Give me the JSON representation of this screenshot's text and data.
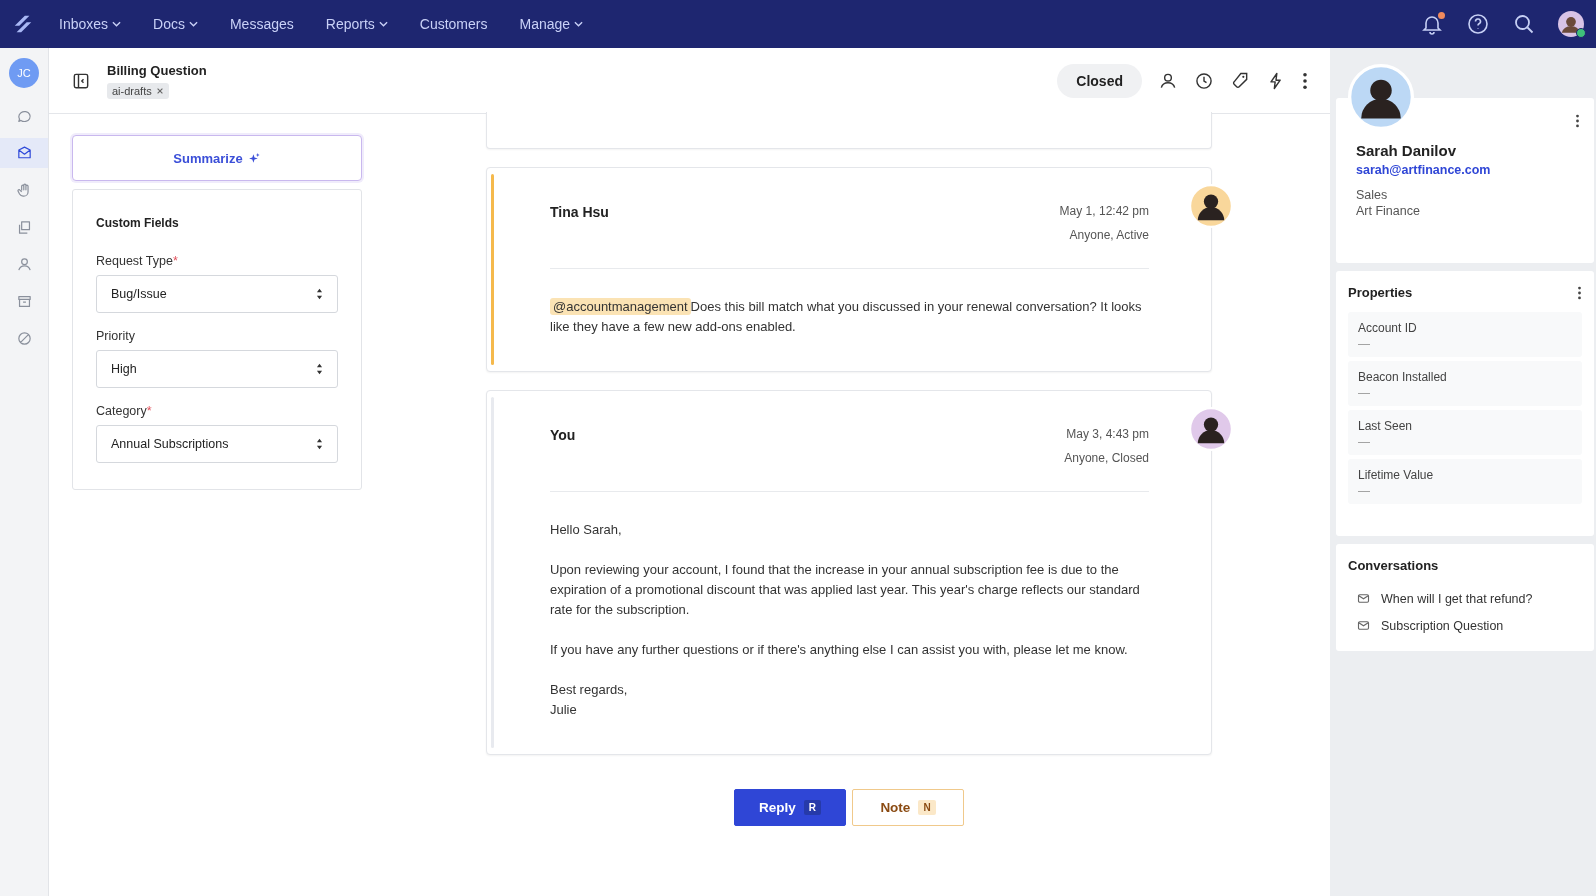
{
  "nav": [
    {
      "label": "Inboxes",
      "dropdown": true
    },
    {
      "label": "Docs",
      "dropdown": true
    },
    {
      "label": "Messages",
      "dropdown": false
    },
    {
      "label": "Reports",
      "dropdown": true
    },
    {
      "label": "Customers",
      "dropdown": false
    },
    {
      "label": "Manage",
      "dropdown": true
    }
  ],
  "top_icons": {
    "notification": true,
    "online": true
  },
  "rail": {
    "user_initials": "JC",
    "items": [
      {
        "kind": "chat",
        "selected": false
      },
      {
        "kind": "inbox",
        "selected": true
      },
      {
        "kind": "hand",
        "selected": false
      },
      {
        "kind": "layers",
        "selected": false
      },
      {
        "kind": "person",
        "selected": false
      },
      {
        "kind": "archive",
        "selected": false
      },
      {
        "kind": "block",
        "selected": false
      }
    ]
  },
  "header": {
    "title": "Billing Question",
    "tag": "ai-drafts",
    "status": "Closed"
  },
  "summarize": "Summarize",
  "custom_fields": {
    "title": "Custom Fields",
    "fields": [
      {
        "label": "Request Type",
        "required_mark": "*",
        "value": "Bug/Issue"
      },
      {
        "label": "Priority",
        "value": "High"
      },
      {
        "label": "Category",
        "required_mark": "*",
        "value": "Annual Subscriptions"
      }
    ]
  },
  "messages": [
    {
      "kind": "note",
      "author": "Tina Hsu",
      "time": "May 1, 12:42 pm",
      "meta": "Anyone, Active",
      "mention": "@accountmanagement",
      "paragraphs": [
        [
          "Does this bill match what you discussed in your renewal conversation? It looks like they have a few new add-ons enabled."
        ]
      ]
    },
    {
      "kind": "reply",
      "author": "You",
      "time": "May 3, 4:43 pm",
      "meta": "Anyone, Closed",
      "paragraphs": [
        [
          "Hello Sarah,"
        ],
        [
          "Upon reviewing your account, I found that the increase in your annual subscription fee is due to the expiration of a promotional discount that was applied last year. This year's charge reflects our standard rate for the subscription."
        ],
        [
          "If you have any further questions or if there's anything else I can assist you with, please let me know."
        ],
        [
          "Best regards,",
          "Julie"
        ]
      ]
    }
  ],
  "actions": [
    {
      "kind": "reply",
      "label": "Reply",
      "key": "R"
    },
    {
      "kind": "note",
      "label": "Note",
      "key": "N"
    }
  ],
  "customer": {
    "name": "Sarah Danilov",
    "email": "sarah@artfinance.com",
    "role": "Sales",
    "company": "Art Finance"
  },
  "properties": {
    "title": "Properties",
    "items": [
      {
        "label": "Account ID",
        "value": "—"
      },
      {
        "label": "Beacon Installed",
        "value": "—"
      },
      {
        "label": "Last Seen",
        "value": "—"
      },
      {
        "label": "Lifetime Value",
        "value": "—"
      }
    ]
  },
  "conversations": {
    "title": "Conversations",
    "items": [
      "When will I get that refund?",
      "Subscription Question"
    ]
  }
}
